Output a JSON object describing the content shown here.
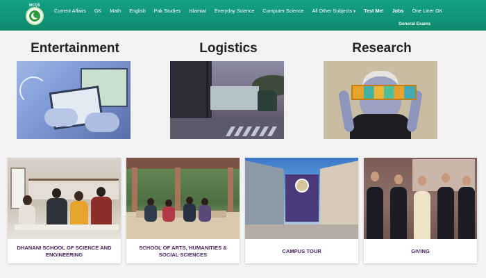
{
  "nav": {
    "logo_text": "MCQS",
    "items": [
      "Current Affairs",
      "GK",
      "Math",
      "English",
      "Pak Studies",
      "Islamiat",
      "Everyday Science",
      "Computer Science",
      "All Other Subjects"
    ],
    "caret": "▾",
    "bold_items": [
      "Test Me!",
      "Jobs",
      "One Liner GK"
    ],
    "second_row": "General Exams",
    "color": "#14a184"
  },
  "features": [
    {
      "title": "Entertainment"
    },
    {
      "title": "Logistics"
    },
    {
      "title": "Research"
    }
  ],
  "cards": [
    {
      "label": "DHANANI SCHOOL OF SCIENCE AND ENGINEERING"
    },
    {
      "label": "SCHOOL OF ARTS, HUMANITIES & SOCIAL SCIENCES"
    },
    {
      "label": "CAMPUS TOUR"
    },
    {
      "label": "GIVING"
    }
  ],
  "colors": {
    "card_text": "#4b1f5c",
    "heading": "#222222",
    "band_bg": "#f2f2f2"
  }
}
